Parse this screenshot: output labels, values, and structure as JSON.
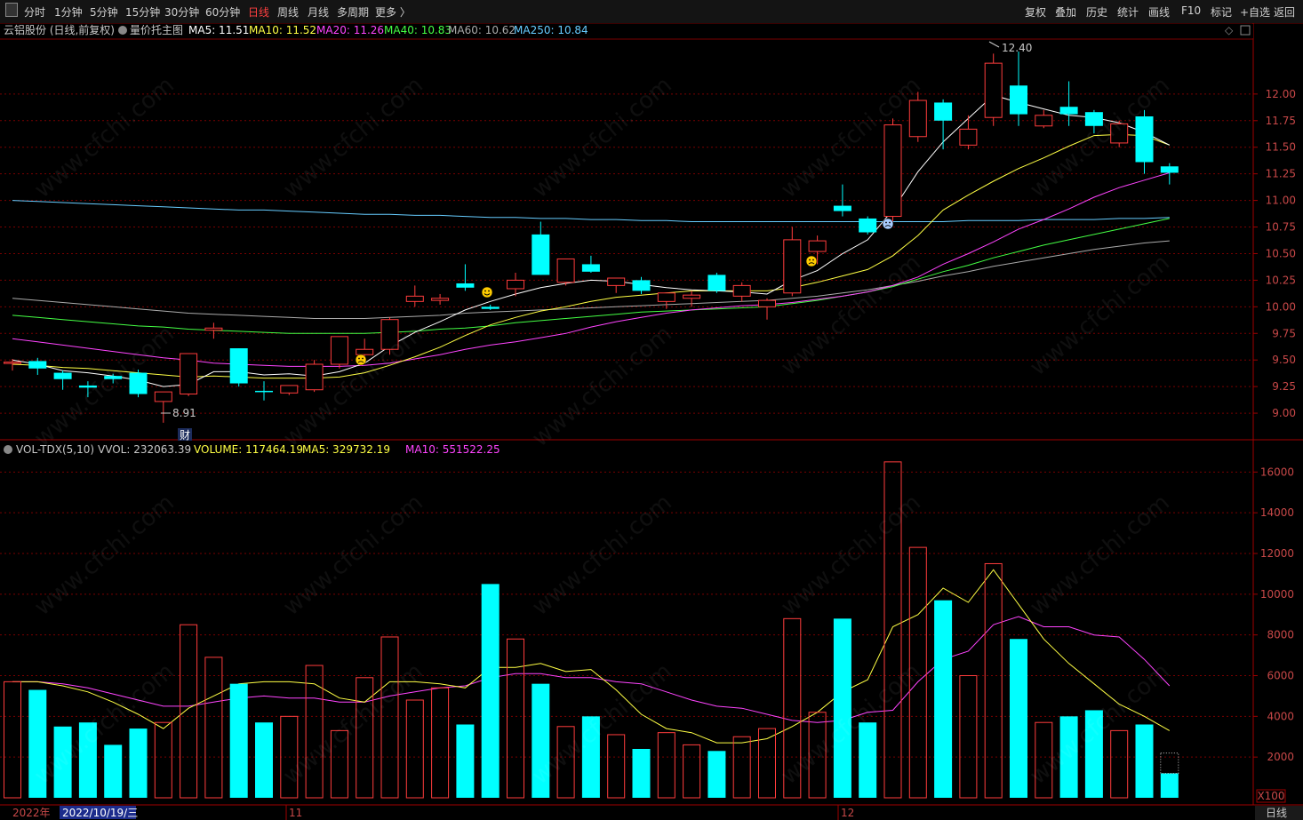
{
  "toolbar": {
    "left": [
      "分时",
      "1分钟",
      "5分钟",
      "15分钟",
      "30分钟",
      "60分钟",
      "日线",
      "周线",
      "月线",
      "多周期",
      "更多 〉"
    ],
    "active": "日线",
    "right": [
      "复权",
      "叠加",
      "历史",
      "统计",
      "画线",
      "F10",
      "标记",
      "+自选",
      "返回"
    ]
  },
  "price_header": {
    "stock": "云铝股份 (日线,前复权)",
    "main_chart": "量价托主图",
    "ma": [
      {
        "label": "MA5: 11.51",
        "color": "#ffffff"
      },
      {
        "label": "MA10: 11.52",
        "color": "#ffff44"
      },
      {
        "label": "MA20: 11.26",
        "color": "#ff44ff"
      },
      {
        "label": "MA40: 10.83",
        "color": "#44ff44"
      },
      {
        "label": "MA60: 10.62",
        "color": "#aaaaaa"
      },
      {
        "label": "MA250: 10.84",
        "color": "#66ccff"
      }
    ]
  },
  "volume_header": {
    "name": "VOL-TDX(5,10)",
    "items": [
      {
        "label": "VVOL: 232063.39",
        "color": "#c8c8c8"
      },
      {
        "label": "VOLUME: 117464.19",
        "color": "#ffff44"
      },
      {
        "label": "MA5: 329732.19",
        "color": "#ffff44"
      },
      {
        "label": "MA10: 551522.25",
        "color": "#ff44ff"
      }
    ]
  },
  "annotations": {
    "high": "12.40",
    "low": "8.91",
    "cai": "财",
    "volume_unit": "X100"
  },
  "date_axis": {
    "year": "2022年",
    "selected": "2022/10/19/三",
    "month_nov": "11",
    "month_dec": "12",
    "period": "日线"
  },
  "colors": {
    "up": "#ff3c3c",
    "down": "#00ffff",
    "grid": "#7a0000",
    "ma5": "#ffffff",
    "ma10": "#ffff44",
    "ma20": "#ff44ff",
    "ma40": "#44ff44",
    "ma60": "#aaaaaa",
    "ma250": "#66ccff"
  },
  "watermark": "www.cfchi.com",
  "chart_data": [
    {
      "type": "candlestick",
      "ylim": [
        8.75,
        12.55
      ],
      "yticks": [
        9.0,
        9.25,
        9.5,
        9.75,
        10.0,
        10.25,
        10.5,
        10.75,
        11.0,
        11.25,
        11.5,
        11.75,
        12.0
      ],
      "candles": [
        [
          9.48,
          9.51,
          9.4,
          9.48
        ],
        [
          9.49,
          9.52,
          9.36,
          9.42
        ],
        [
          9.38,
          9.4,
          9.22,
          9.32
        ],
        [
          9.26,
          9.3,
          9.15,
          9.24
        ],
        [
          9.35,
          9.37,
          9.28,
          9.32
        ],
        [
          9.38,
          9.41,
          9.15,
          9.18
        ],
        [
          9.11,
          9.2,
          8.91,
          9.2
        ],
        [
          9.18,
          9.4,
          9.16,
          9.56
        ],
        [
          9.78,
          9.85,
          9.7,
          9.8
        ],
        [
          9.61,
          9.61,
          9.25,
          9.28
        ],
        [
          9.21,
          9.3,
          9.12,
          9.2
        ],
        [
          9.19,
          9.22,
          9.17,
          9.26
        ],
        [
          9.22,
          9.5,
          9.2,
          9.46
        ],
        [
          9.46,
          9.68,
          9.42,
          9.72
        ],
        [
          9.55,
          9.7,
          9.5,
          9.6
        ],
        [
          9.6,
          9.9,
          9.55,
          9.88
        ],
        [
          10.05,
          10.2,
          10.0,
          10.1
        ],
        [
          10.06,
          10.12,
          10.02,
          10.08
        ],
        [
          10.22,
          10.4,
          10.15,
          10.18
        ],
        [
          10.0,
          10.02,
          9.97,
          9.98
        ],
        [
          10.17,
          10.32,
          10.1,
          10.25
        ],
        [
          10.68,
          10.8,
          10.3,
          10.3
        ],
        [
          10.23,
          10.35,
          10.2,
          10.45
        ],
        [
          10.4,
          10.48,
          10.32,
          10.33
        ],
        [
          10.2,
          10.27,
          10.13,
          10.27
        ],
        [
          10.25,
          10.28,
          10.12,
          10.15
        ],
        [
          10.05,
          10.1,
          9.98,
          10.13
        ],
        [
          10.08,
          10.15,
          10.0,
          10.11
        ],
        [
          10.3,
          10.32,
          10.13,
          10.15
        ],
        [
          10.1,
          10.23,
          10.05,
          10.2
        ],
        [
          10.0,
          10.08,
          9.88,
          10.06
        ],
        [
          10.13,
          10.75,
          10.1,
          10.63
        ],
        [
          10.52,
          10.67,
          10.4,
          10.62
        ],
        [
          10.95,
          11.15,
          10.85,
          10.9
        ],
        [
          10.83,
          10.85,
          10.68,
          10.7
        ],
        [
          10.85,
          11.77,
          10.8,
          11.71
        ],
        [
          11.6,
          12.02,
          11.55,
          11.94
        ],
        [
          11.92,
          11.95,
          11.48,
          11.75
        ],
        [
          11.52,
          11.8,
          11.48,
          11.67
        ],
        [
          11.78,
          12.38,
          11.7,
          12.29
        ],
        [
          12.08,
          12.4,
          11.7,
          11.81
        ],
        [
          11.7,
          11.85,
          11.68,
          11.8
        ],
        [
          11.88,
          12.12,
          11.7,
          11.81
        ],
        [
          11.83,
          11.85,
          11.63,
          11.7
        ],
        [
          11.54,
          11.75,
          11.5,
          11.72
        ],
        [
          11.79,
          11.85,
          11.25,
          11.36
        ],
        [
          11.32,
          11.35,
          11.15,
          11.26
        ]
      ],
      "ma5": [
        9.5,
        9.46,
        9.4,
        9.38,
        9.35,
        9.31,
        9.25,
        9.27,
        9.39,
        9.39,
        9.36,
        9.37,
        9.35,
        9.39,
        9.47,
        9.63,
        9.76,
        9.86,
        9.97,
        10.05,
        10.12,
        10.18,
        10.22,
        10.25,
        10.24,
        10.21,
        10.18,
        10.16,
        10.15,
        10.14,
        10.12,
        10.25,
        10.34,
        10.5,
        10.63,
        10.91,
        11.27,
        11.55,
        11.77,
        11.99,
        11.92,
        11.86,
        11.8,
        11.78,
        11.73,
        11.64,
        11.52
      ],
      "ma10": [
        9.46,
        9.45,
        9.43,
        9.42,
        9.4,
        9.38,
        9.36,
        9.34,
        9.35,
        9.34,
        9.33,
        9.33,
        9.33,
        9.34,
        9.38,
        9.45,
        9.53,
        9.62,
        9.73,
        9.83,
        9.9,
        9.96,
        10.0,
        10.05,
        10.09,
        10.11,
        10.13,
        10.15,
        10.15,
        10.15,
        10.15,
        10.18,
        10.23,
        10.29,
        10.35,
        10.48,
        10.67,
        10.91,
        11.05,
        11.18,
        11.3,
        11.4,
        11.51,
        11.61,
        11.62,
        11.61,
        11.52
      ],
      "ma20": [
        9.7,
        9.67,
        9.64,
        9.61,
        9.58,
        9.55,
        9.52,
        9.5,
        9.47,
        9.46,
        9.45,
        9.44,
        9.44,
        9.44,
        9.45,
        9.47,
        9.51,
        9.55,
        9.6,
        9.64,
        9.67,
        9.71,
        9.75,
        9.81,
        9.86,
        9.9,
        9.94,
        9.97,
        9.99,
        10.01,
        10.02,
        10.04,
        10.07,
        10.1,
        10.14,
        10.2,
        10.28,
        10.4,
        10.5,
        10.61,
        10.73,
        10.82,
        10.92,
        11.03,
        11.12,
        11.19,
        11.26
      ],
      "ma40": [
        9.92,
        9.9,
        9.88,
        9.86,
        9.84,
        9.82,
        9.81,
        9.79,
        9.78,
        9.77,
        9.76,
        9.75,
        9.75,
        9.75,
        9.75,
        9.76,
        9.77,
        9.79,
        9.8,
        9.82,
        9.85,
        9.87,
        9.89,
        9.91,
        9.93,
        9.95,
        9.96,
        9.97,
        9.98,
        9.99,
        10.0,
        10.03,
        10.06,
        10.1,
        10.14,
        10.19,
        10.26,
        10.33,
        10.39,
        10.46,
        10.52,
        10.58,
        10.63,
        10.68,
        10.73,
        10.78,
        10.83
      ],
      "ma60": [
        10.08,
        10.06,
        10.04,
        10.02,
        10.0,
        9.98,
        9.96,
        9.94,
        9.93,
        9.92,
        9.91,
        9.9,
        9.89,
        9.89,
        9.89,
        9.9,
        9.91,
        9.92,
        9.94,
        9.95,
        9.96,
        9.97,
        9.98,
        9.99,
        10.0,
        10.01,
        10.02,
        10.03,
        10.04,
        10.05,
        10.06,
        10.08,
        10.1,
        10.13,
        10.16,
        10.2,
        10.24,
        10.29,
        10.33,
        10.38,
        10.42,
        10.46,
        10.5,
        10.54,
        10.57,
        10.6,
        10.62
      ],
      "ma250": [
        11.0,
        10.99,
        10.98,
        10.97,
        10.96,
        10.95,
        10.94,
        10.93,
        10.92,
        10.91,
        10.91,
        10.9,
        10.89,
        10.88,
        10.87,
        10.87,
        10.86,
        10.86,
        10.85,
        10.84,
        10.84,
        10.83,
        10.83,
        10.82,
        10.82,
        10.81,
        10.81,
        10.8,
        10.8,
        10.8,
        10.8,
        10.8,
        10.8,
        10.8,
        10.8,
        10.8,
        10.8,
        10.8,
        10.81,
        10.81,
        10.81,
        10.82,
        10.82,
        10.82,
        10.83,
        10.83,
        10.84
      ]
    },
    {
      "type": "bar",
      "ylim": [
        0,
        16800
      ],
      "yticks": [
        2000,
        4000,
        6000,
        8000,
        10000,
        12000,
        14000,
        16000
      ],
      "volume": [
        5700,
        5300,
        3500,
        3700,
        2600,
        3400,
        3700,
        8500,
        6900,
        5600,
        3700,
        4000,
        6500,
        3300,
        5900,
        7900,
        4800,
        5400,
        3600,
        10500,
        7800,
        5600,
        3500,
        4000,
        3100,
        2400,
        3200,
        2600,
        2300,
        3000,
        3400,
        8800,
        4200,
        8800,
        3700,
        16500,
        12300,
        9700,
        6000,
        11500,
        7800,
        3700,
        4000,
        4300,
        3300,
        3600,
        1200
      ],
      "ma5": [
        5700,
        5700,
        5500,
        5200,
        4700,
        4100,
        3400,
        4400,
        5000,
        5600,
        5700,
        5700,
        5600,
        4900,
        4700,
        5700,
        5700,
        5600,
        5400,
        6400,
        6400,
        6600,
        6200,
        6300,
        5300,
        4100,
        3400,
        3200,
        2700,
        2700,
        2900,
        3500,
        4200,
        5200,
        5800,
        8400,
        9000,
        10300,
        9600,
        11200,
        9500,
        7800,
        6600,
        5600,
        4600,
        4000,
        3300
      ],
      "ma10": [
        5700,
        5700,
        5600,
        5400,
        5100,
        4800,
        4500,
        4500,
        4700,
        4900,
        5000,
        4900,
        4900,
        4700,
        4700,
        5000,
        5200,
        5400,
        5500,
        5900,
        6100,
        6100,
        5900,
        5900,
        5700,
        5600,
        5200,
        4800,
        4500,
        4400,
        4100,
        3800,
        3700,
        3800,
        4200,
        4300,
        5700,
        6800,
        7200,
        8500,
        8900,
        8400,
        8400,
        8000,
        7900,
        6800,
        5500
      ]
    }
  ]
}
